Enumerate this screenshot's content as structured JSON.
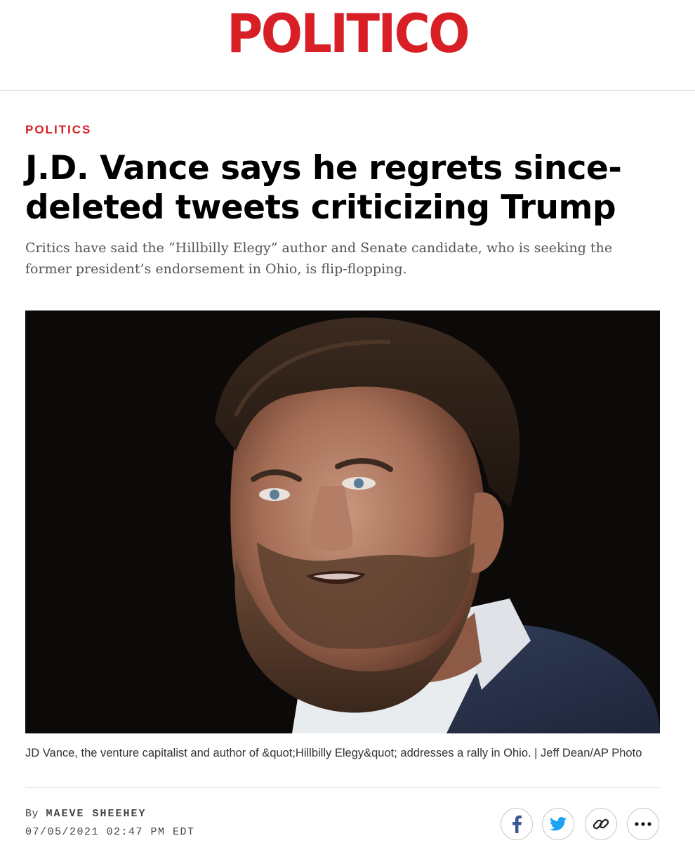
{
  "brand": {
    "logo_text": "POLITICO",
    "logo_color": "#d91f26"
  },
  "article": {
    "section": "POLITICS",
    "headline": "J.D. Vance says he regrets since-deleted tweets criticizing Trump",
    "dek": "Critics have said the “Hillbilly Elegy” author and Senate candidate, who is seeking the former president’s endorsement in Ohio, is flip-flopping.",
    "photo_alt": "JD Vance speaking",
    "caption": "JD Vance, the venture capitalist and author of &quot;Hillbilly Elegy&quot; addresses a rally in Ohio. | Jeff Dean/AP Photo",
    "byline_prefix": "By",
    "author": "MAEVE SHEEHEY",
    "timestamp": "07/05/2021 02:47 PM EDT"
  },
  "share": {
    "facebook_icon": "facebook-icon",
    "twitter_icon": "twitter-icon",
    "link_icon": "link-icon",
    "more_icon": "more-dots-icon",
    "facebook_color": "#3b5998",
    "twitter_color": "#1da1f2"
  }
}
